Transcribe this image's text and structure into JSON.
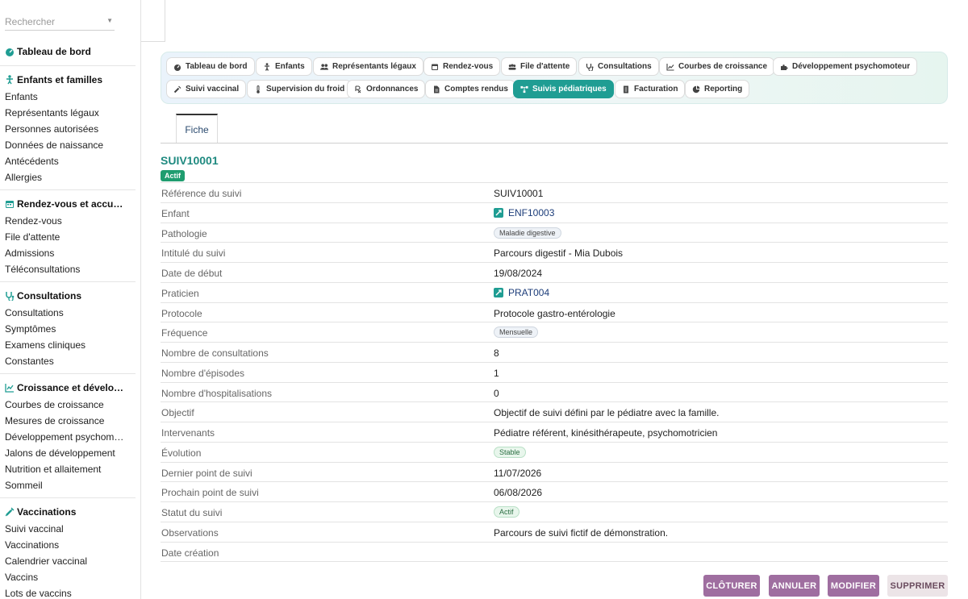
{
  "sidebar": {
    "search_placeholder": "Rechercher",
    "dashboard": "Tableau de bord",
    "sections": [
      {
        "title": "Enfants et familles",
        "icon": "child-icon",
        "items": [
          "Enfants",
          "Représentants légaux",
          "Personnes autorisées",
          "Données de naissance",
          "Antécédents",
          "Allergies"
        ]
      },
      {
        "title": "Rendez-vous et accu…",
        "icon": "calendar-icon",
        "items": [
          "Rendez-vous",
          "File d'attente",
          "Admissions",
          "Téléconsultations"
        ]
      },
      {
        "title": "Consultations",
        "icon": "stethoscope-icon",
        "items": [
          "Consultations",
          "Symptômes",
          "Examens cliniques",
          "Constantes"
        ]
      },
      {
        "title": "Croissance et dévelo…",
        "icon": "chart-line-icon",
        "items": [
          "Courbes de croissance",
          "Mesures de croissance",
          "Développement psychom…",
          "Jalons de développement",
          "Nutrition et allaitement",
          "Sommeil"
        ]
      },
      {
        "title": "Vaccinations",
        "icon": "syringe-icon",
        "items": [
          "Suivi vaccinal",
          "Vaccinations",
          "Calendrier vaccinal",
          "Vaccins",
          "Lots de vaccins"
        ]
      }
    ]
  },
  "tabs": [
    {
      "label": "Tableau de bord",
      "icon": "dashboard-icon"
    },
    {
      "label": "Enfants",
      "icon": "child-icon"
    },
    {
      "label": "Représentants légaux",
      "icon": "users-icon"
    },
    {
      "label": "Rendez-vous",
      "icon": "calendar-icon"
    },
    {
      "label": "File d'attente",
      "icon": "queue-icon"
    },
    {
      "label": "Consultations",
      "icon": "stethoscope-icon"
    },
    {
      "label": "Courbes de croissance",
      "icon": "chart-line-icon"
    },
    {
      "label": "Développement psychomoteur",
      "icon": "puzzle-icon"
    },
    {
      "label": "Suivi vaccinal",
      "icon": "syringe-icon"
    },
    {
      "label": "Supervision du froid",
      "icon": "thermometer-icon"
    },
    {
      "label": "Ordonnances",
      "icon": "prescription-icon"
    },
    {
      "label": "Comptes rendus",
      "icon": "file-icon"
    },
    {
      "label": "Suivis pédiatriques",
      "icon": "sitemap-icon",
      "active": true
    },
    {
      "label": "Facturation",
      "icon": "invoice-icon"
    },
    {
      "label": "Reporting",
      "icon": "pie-chart-icon"
    }
  ],
  "form_tab": "Fiche",
  "record": {
    "title": "SUIV10001",
    "status_badge": "Actif",
    "fields": [
      {
        "label": "Référence du suivi",
        "value": "SUIV10001",
        "type": "text"
      },
      {
        "label": "Enfant",
        "value": "ENF10003",
        "type": "link"
      },
      {
        "label": "Pathologie",
        "value": "Maladie digestive",
        "type": "pill"
      },
      {
        "label": "Intitulé du suivi",
        "value": "Parcours digestif - Mia Dubois",
        "type": "text"
      },
      {
        "label": "Date de début",
        "value": "19/08/2024",
        "type": "text"
      },
      {
        "label": "Praticien",
        "value": "PRAT004",
        "type": "link"
      },
      {
        "label": "Protocole",
        "value": "Protocole gastro-entérologie",
        "type": "text"
      },
      {
        "label": "Fréquence",
        "value": "Mensuelle",
        "type": "pill"
      },
      {
        "label": "Nombre de consultations",
        "value": "8",
        "type": "text"
      },
      {
        "label": "Nombre d'épisodes",
        "value": "1",
        "type": "text"
      },
      {
        "label": "Nombre d'hospitalisations",
        "value": "0",
        "type": "text"
      },
      {
        "label": "Objectif",
        "value": "Objectif de suivi défini par le pédiatre avec la famille.",
        "type": "text"
      },
      {
        "label": "Intervenants",
        "value": "Pédiatre référent, kinésithérapeute, psychomotricien",
        "type": "text"
      },
      {
        "label": "Évolution",
        "value": "Stable",
        "type": "pill-green"
      },
      {
        "label": "Dernier point de suivi",
        "value": "11/07/2026",
        "type": "text"
      },
      {
        "label": "Prochain point de suivi",
        "value": "06/08/2026",
        "type": "text"
      },
      {
        "label": "Statut du suivi",
        "value": "Actif",
        "type": "pill-green"
      },
      {
        "label": "Observations",
        "value": "Parcours de suivi fictif de démonstration.",
        "type": "text"
      },
      {
        "label": "Date création",
        "value": "",
        "type": "text"
      }
    ]
  },
  "actions": {
    "close": "CLÔTURER",
    "cancel": "ANNULER",
    "edit": "MODIFIER",
    "delete": "SUPPRIMER"
  },
  "colors": {
    "accent": "#1f9d93",
    "title": "#1f8a80",
    "button": "#9f6ea0",
    "link": "#1c3d7a"
  }
}
